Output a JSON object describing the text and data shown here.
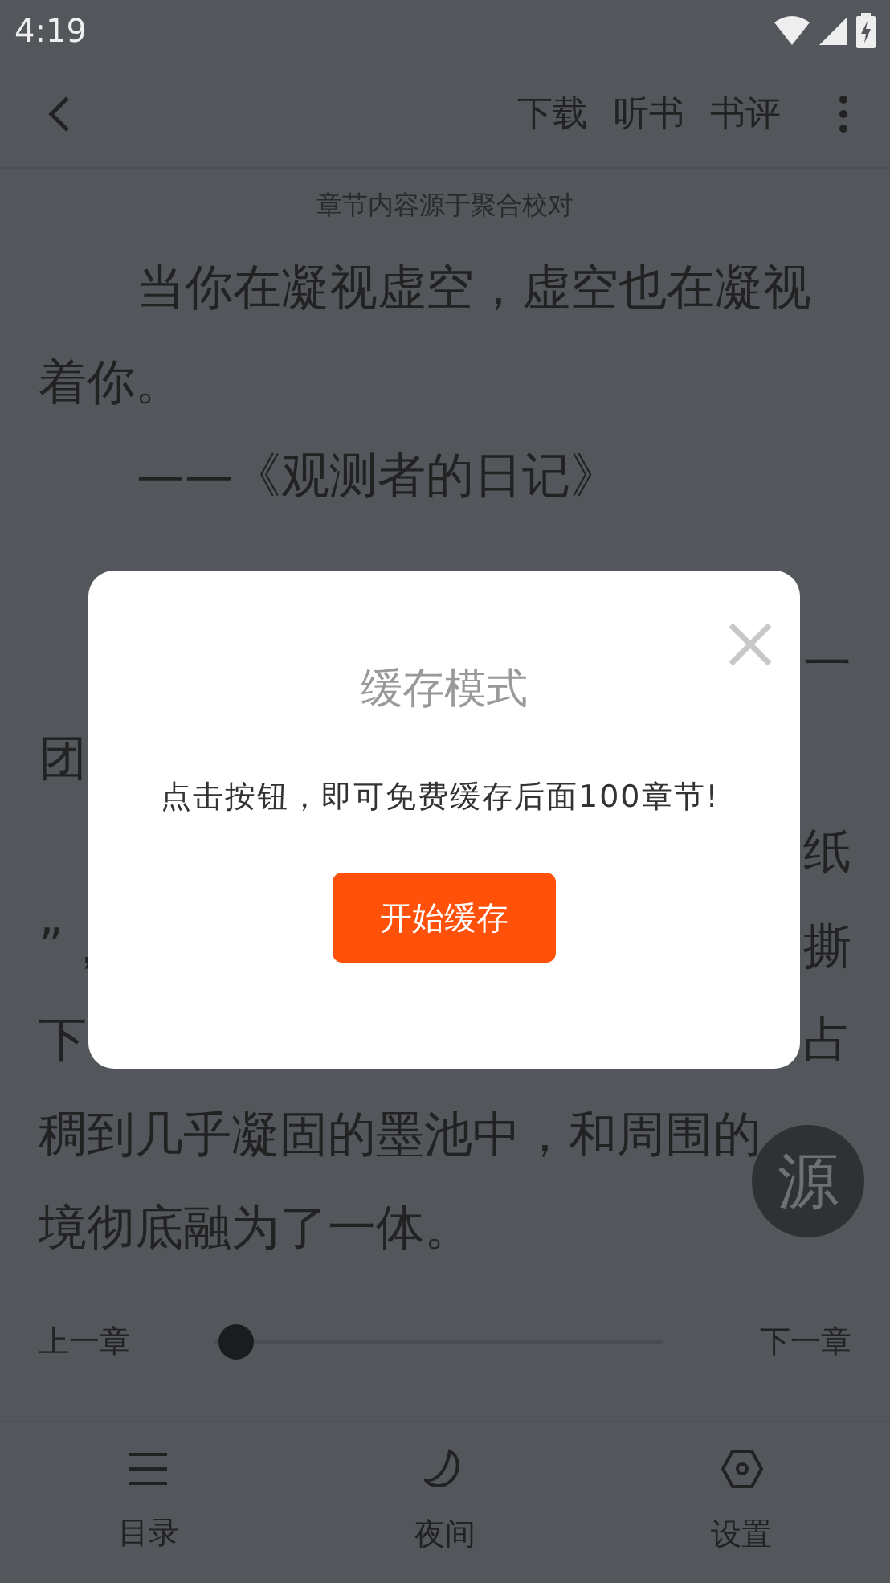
{
  "status_bar": {
    "time": "4:19"
  },
  "toolbar": {
    "actions": [
      "下载",
      "听书",
      "书评"
    ]
  },
  "source_note": "章节内容源于聚合校对",
  "text_lines": [
    {
      "left": "当你在凝视虚空，虚空也在凝视",
      "indent": true
    },
    {
      "left": "着你。",
      "indent": false
    },
    {
      "left": "——《观测者的日记》",
      "indent": true
    },
    {
      "right": "一"
    },
    {
      "left": "团",
      "indent": false
    },
    {
      "right": "纸"
    },
    {
      "left": "”，",
      "right": "撕",
      "indent": false
    },
    {
      "left": "下",
      "right": "占",
      "indent": false
    },
    {
      "left": "稠到几乎凝固的墨池中，和周围的",
      "indent": false
    },
    {
      "left": "境彻底融为了一体。",
      "indent": false
    }
  ],
  "source_button": "源",
  "chapter_nav": {
    "prev": "上一章",
    "next": "下一章",
    "level": 0.03
  },
  "bottom_nav": [
    {
      "label": "目录",
      "kind": "menu"
    },
    {
      "label": "夜间",
      "kind": "moon"
    },
    {
      "label": "设置",
      "kind": "settings"
    }
  ],
  "dialog": {
    "title": "缓存模式",
    "message": "点击按钮，即可免费缓存后面100章节!",
    "button": "开始缓存"
  }
}
